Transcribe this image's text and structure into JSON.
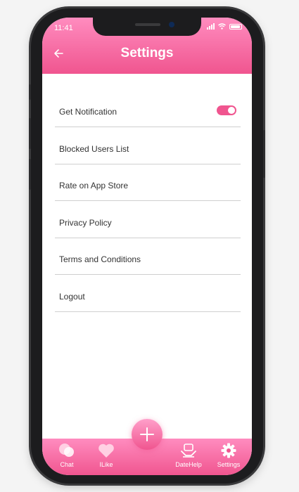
{
  "status": {
    "time": "11:41"
  },
  "header": {
    "title": "Settings",
    "back_icon": "arrow-left-icon"
  },
  "settings": {
    "items": [
      {
        "label": "Get Notification",
        "toggle": true,
        "toggle_on": true
      },
      {
        "label": "Blocked Users List"
      },
      {
        "label": "Rate on App Store"
      },
      {
        "label": "Privacy Policy"
      },
      {
        "label": "Terms and Conditions"
      },
      {
        "label": "Logout"
      }
    ]
  },
  "tabbar": {
    "tabs": [
      {
        "label": "Chat",
        "icon": "chat-bubbles-icon"
      },
      {
        "label": "ILike",
        "icon": "heart-icon"
      },
      {
        "label": "DateHelp",
        "icon": "helping-hands-icon"
      },
      {
        "label": "Settings",
        "icon": "gear-icon"
      }
    ],
    "fab_icon": "plus-icon"
  },
  "colors": {
    "accent": "#f0558f",
    "accent_light": "#ff8cbf"
  }
}
